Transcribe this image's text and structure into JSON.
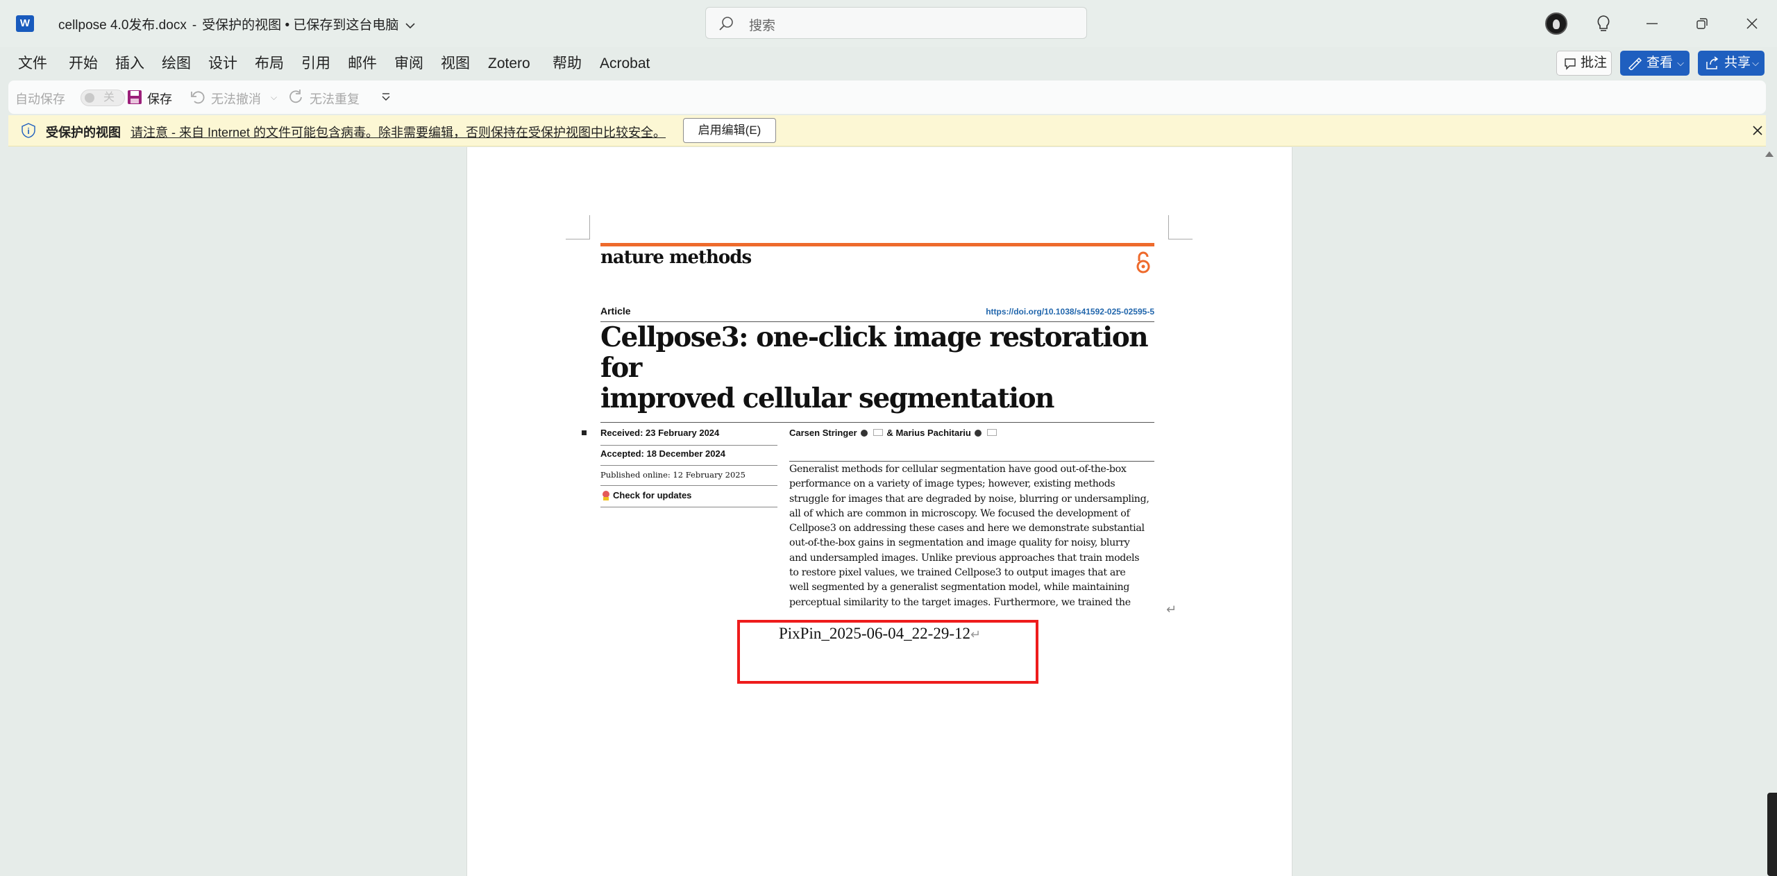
{
  "titlebar": {
    "app_icon_letter": "W",
    "file_name": "cellpose 4.0发布.docx",
    "separator": "-",
    "view_mode": "受保护的视图",
    "bullet": "•",
    "save_status": "已保存到这台电脑",
    "search_placeholder": "搜索"
  },
  "menu": {
    "items": [
      "文件",
      "开始",
      "插入",
      "绘图",
      "设计",
      "布局",
      "引用",
      "邮件",
      "审阅",
      "视图",
      "Zotero",
      "帮助",
      "Acrobat"
    ],
    "comment_label": "批注",
    "view_button_label": "查看",
    "share_button_label": "共享"
  },
  "quick_access": {
    "autosave_label": "自动保存",
    "autosave_state": "关",
    "save_label": "保存",
    "undo_label": "无法撤消",
    "redo_label": "无法重复"
  },
  "protected_bar": {
    "title": "受保护的视图",
    "message": "请注意 - 来自 Internet 的文件可能包含病毒。除非需要编辑，否则保持在受保护视图中比较安全。",
    "enable_button": "启用编辑(E)"
  },
  "article": {
    "journal": "nature methods",
    "label": "Article",
    "doi": "https://doi.org/10.1038/s41592-025-02595-5",
    "title_line1": "Cellpose3: one-click image restoration for",
    "title_line2": "improved cellular segmentation",
    "received": "Received: 23 February 2024",
    "accepted": "Accepted: 18 December 2024",
    "published": "Published online: 12 February 2025",
    "check_updates": "Check for updates",
    "author1": "Carsen Stringer",
    "author_sep": "&",
    "author2": "Marius Pachitariu",
    "abstract_lines": [
      "Generalist methods for cellular segmentation have good out-of-the-box",
      "performance on a variety of image types; however, existing methods",
      "struggle for images that are degraded by noise, blurring or undersampling,",
      "all of which are common in microscopy. We focused the development of",
      "Cellpose3 on addressing these cases and here we demonstrate substantial",
      "out-of-the-box gains in segmentation and image quality for noisy, blurry",
      "and undersampled images. Unlike previous approaches that train models",
      "to restore pixel values, we trained Cellpose3 to output images that are",
      "well segmented by a generalist segmentation model, while maintaining",
      "perceptual similarity to the target images. Furthermore, we trained the"
    ]
  },
  "caption": {
    "text": "PixPin_2025-06-04_22-29-12",
    "paragraph_mark": "↵"
  },
  "colors": {
    "brand_blue": "#1f5fbf",
    "nature_orange": "#ee6a2c",
    "highlight_red": "#ee1c1c"
  }
}
